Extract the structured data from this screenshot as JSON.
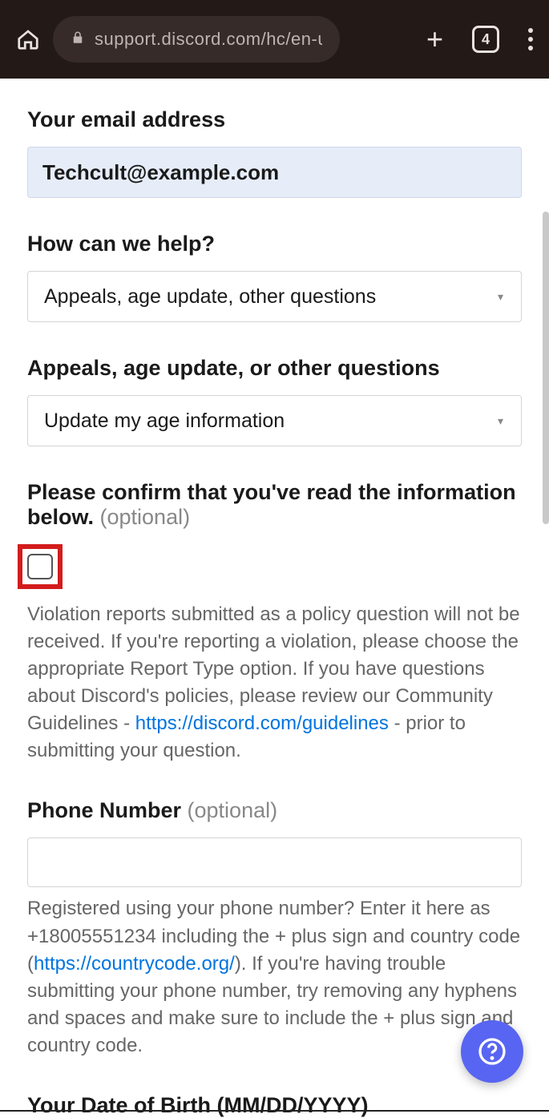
{
  "browser": {
    "url": "support.discord.com/hc/en-us/requ",
    "tab_count": "4"
  },
  "form": {
    "email": {
      "label": "Your email address",
      "value": "Techcult@example.com"
    },
    "help": {
      "label": "How can we help?",
      "value": "Appeals, age update, other questions"
    },
    "subtype": {
      "label": "Appeals, age update, or other questions",
      "value": "Update my age information"
    },
    "confirm": {
      "label_a": "Please confirm that you've read the information below.",
      "optional": " (optional)",
      "helper_before_link": "Violation reports submitted as a policy question will not be received. If you're reporting a violation, please choose the appropriate Report Type option. If you have questions about Discord's policies, please review our Community Guidelines - ",
      "link_text": "https://discord.com/guidelines",
      "helper_after_link": " - prior to submitting your question."
    },
    "phone": {
      "label": "Phone Number",
      "optional": " (optional)",
      "helper_before": "Registered using your phone number? Enter it here as +18005551234 including the + plus sign and country code (",
      "link_text": "https://countrycode.org/",
      "helper_after": "). If you're having trouble submitting your phone number, try removing any hyphens and spaces and make sure to include the + plus sign and country code."
    },
    "dob": {
      "label": "Your Date of Birth (MM/DD/YYYY)"
    }
  }
}
